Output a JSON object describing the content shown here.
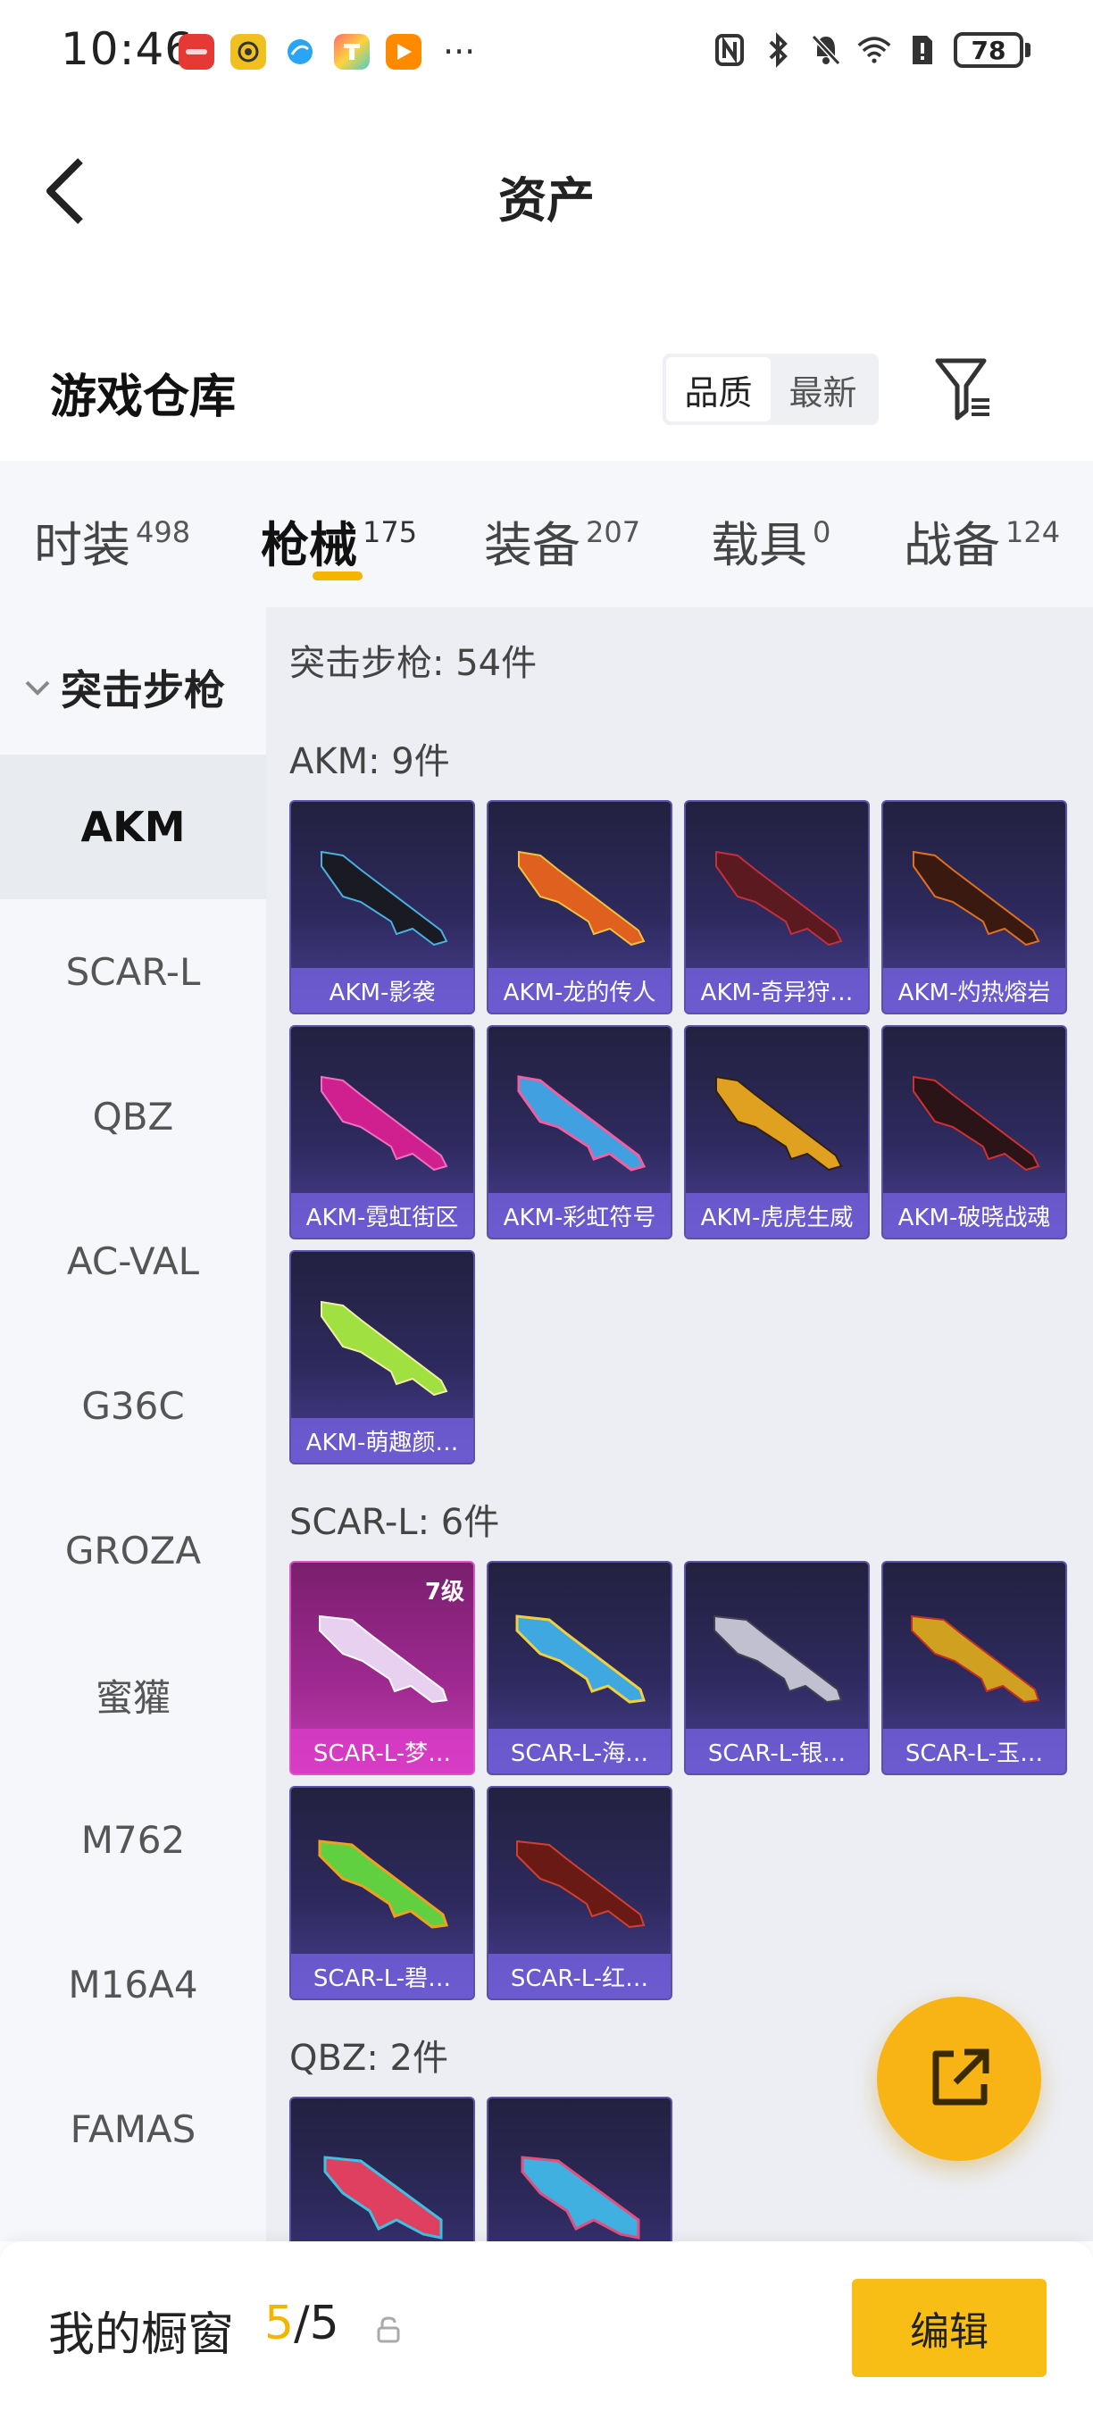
{
  "status_bar": {
    "time": "10:46",
    "battery": "78",
    "app_icons": [
      "huawei-app-icon",
      "camera-app-icon",
      "browser-app-icon",
      "tile-app-icon",
      "video-app-icon"
    ],
    "more": "···"
  },
  "header": {
    "title": "资产"
  },
  "warehouse": {
    "title": "游戏仓库",
    "sort_options": [
      "品质",
      "最新"
    ],
    "sort_selected": "品质"
  },
  "tabs": [
    {
      "label": "时装",
      "count": "498"
    },
    {
      "label": "枪械",
      "count": "175"
    },
    {
      "label": "装备",
      "count": "207"
    },
    {
      "label": "载具",
      "count": "0"
    },
    {
      "label": "战备",
      "count": "124"
    }
  ],
  "active_tab": "枪械",
  "sidebar": {
    "group": "突击步枪",
    "items": [
      "AKM",
      "SCAR-L",
      "QBZ",
      "AC-VAL",
      "G36C",
      "GROZA",
      "蜜獾",
      "M762",
      "M16A4",
      "FAMAS"
    ],
    "active": "AKM"
  },
  "content": {
    "total": "突击步枪: 54件",
    "sections": [
      {
        "title": "AKM: 9件",
        "items": [
          "AKM-影袭",
          "AKM-龙的传人",
          "AKM-奇异狩…",
          "AKM-灼热熔岩",
          "AKM-霓虹街区",
          "AKM-彩虹符号",
          "AKM-虎虎生威",
          "AKM-破晓战魂",
          "AKM-萌趣颜…"
        ]
      },
      {
        "title": "SCAR-L: 6件",
        "items": [
          "SCAR-L-梦…",
          "SCAR-L-海…",
          "SCAR-L-银…",
          "SCAR-L-玉…",
          "SCAR-L-碧…",
          "SCAR-L-红…"
        ],
        "first_level": "7级"
      },
      {
        "title": "QBZ: 2件",
        "items": [
          "",
          ""
        ]
      }
    ]
  },
  "bottom_bar": {
    "label": "我的橱窗",
    "used": "5",
    "sep": "/",
    "total": "5",
    "edit_label": "编辑"
  },
  "colors": {
    "accent": "#f5b400",
    "card_dark": "#2e2a5e",
    "card_pink": "#a02a92"
  }
}
